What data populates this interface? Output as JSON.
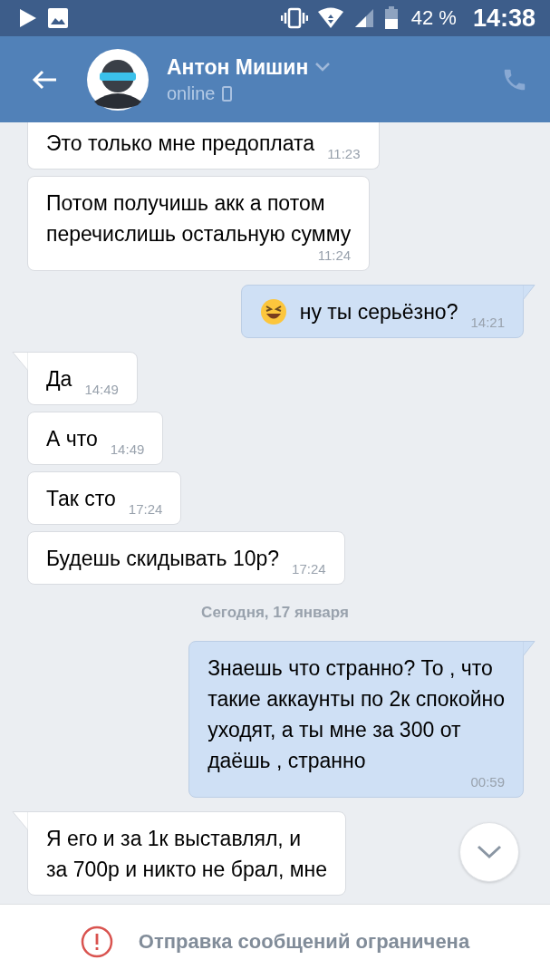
{
  "status_bar": {
    "battery": "42 %",
    "time": "14:38"
  },
  "header": {
    "name": "Антон Мишин",
    "status": "online"
  },
  "chat": [
    {
      "kind": "incoming",
      "tail": false,
      "emoji": false,
      "text": "Это только мне предоплата",
      "time": "11:23"
    },
    {
      "kind": "incoming",
      "tail": false,
      "emoji": false,
      "text": "Потом получишь акк а потом\nперечислишь остальную сумму",
      "time": "11:24"
    },
    {
      "kind": "outgoing",
      "tail": true,
      "emoji": true,
      "text": "ну ты серьёзно?",
      "time": "14:21"
    },
    {
      "kind": "incoming",
      "tail": true,
      "emoji": false,
      "text": "Да",
      "time": "14:49"
    },
    {
      "kind": "incoming",
      "tail": false,
      "emoji": false,
      "text": "А что",
      "time": "14:49"
    },
    {
      "kind": "incoming",
      "tail": false,
      "emoji": false,
      "text": "Так сто",
      "time": "17:24"
    },
    {
      "kind": "incoming",
      "tail": false,
      "emoji": false,
      "text": "Будешь скидывать 10р?",
      "time": "17:24"
    },
    {
      "kind": "date",
      "text": "Сегодня, 17 января"
    },
    {
      "kind": "outgoing",
      "tail": true,
      "emoji": false,
      "text": "Знаешь что странно? То , что\nтакие аккаунты по 2к спокойно\nуходят, а ты мне за 300 от\nдаёшь , странно",
      "time": "00:59"
    },
    {
      "kind": "incoming",
      "tail": true,
      "emoji": false,
      "text": "Я его и за 1к выставлял, и\nза 700р и никто не брал, мне"
    }
  ],
  "footer": {
    "notice": "Отправка сообщений ограничена"
  }
}
